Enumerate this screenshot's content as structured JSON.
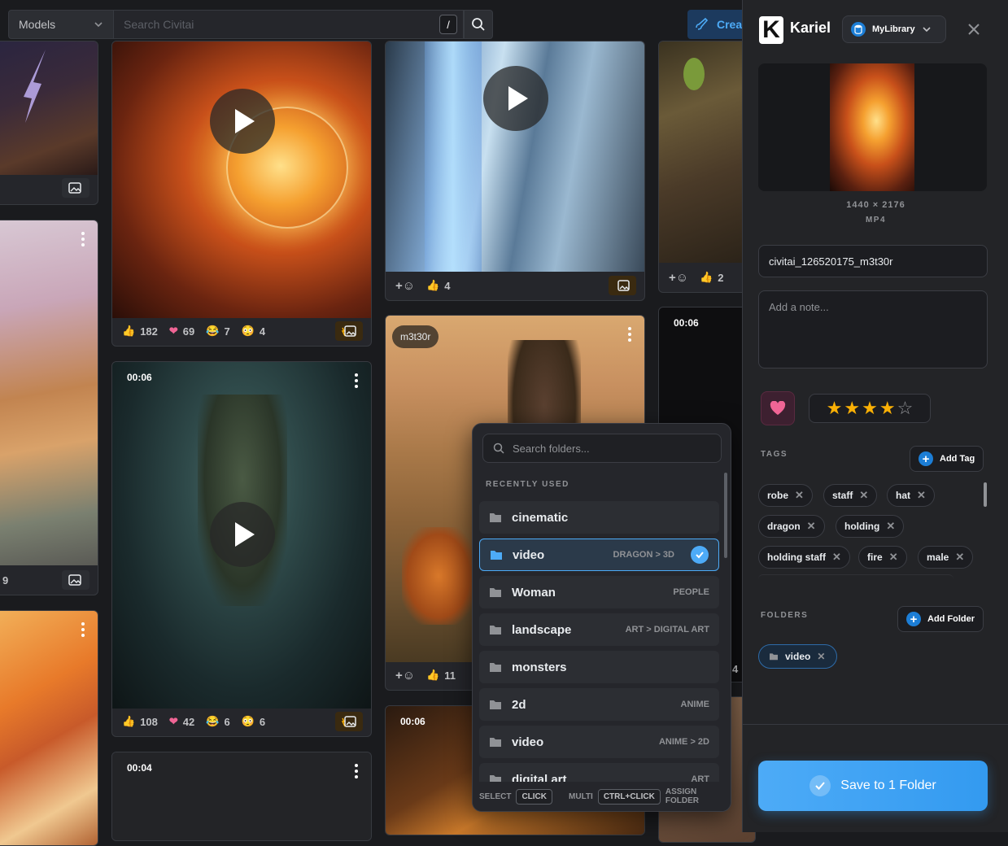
{
  "topbar": {
    "models_label": "Models",
    "search_placeholder": "Search Civitai",
    "slash_key": "/",
    "create_label": "Create"
  },
  "cards": {
    "c1": {
      "footer_count": "9"
    },
    "fire": {
      "likes": "182",
      "hearts": "69",
      "laughs": "7",
      "cries": "4"
    },
    "ice": {
      "likes": "4"
    },
    "wraith": {
      "duration": "00:06",
      "likes": "108",
      "hearts": "42",
      "laughs": "6",
      "cries": "6"
    },
    "scarecrow": {
      "user": "m3t30r",
      "likes": "11"
    },
    "bird": {
      "likes": "2"
    },
    "dark": {
      "duration": "00:06",
      "count": "4"
    },
    "bottom1": {
      "duration": "00:04"
    },
    "bottom2": {
      "duration": "00:06"
    }
  },
  "dropdown": {
    "search_placeholder": "Search folders...",
    "section_label": "RECENTLY USED",
    "folders": [
      {
        "name": "cinematic",
        "path": ""
      },
      {
        "name": "video",
        "path": "DRAGON > 3D"
      },
      {
        "name": "Woman",
        "path": "PEOPLE"
      },
      {
        "name": "landscape",
        "path": "ART > DIGITAL ART"
      },
      {
        "name": "monsters",
        "path": ""
      },
      {
        "name": "2d",
        "path": "ANIME"
      },
      {
        "name": "video",
        "path": "ANIME > 2D"
      },
      {
        "name": "digital art",
        "path": "ART"
      }
    ],
    "footer": {
      "select": "SELECT",
      "click": "CLICK",
      "multi": "MULTI",
      "ctrl_click": "CTRL+CLICK",
      "assign": "ASSIGN FOLDER"
    }
  },
  "panel": {
    "brand_letter": "K",
    "brand_name": "Kariel",
    "library_label": "MyLibrary",
    "dimensions": "1440 × 2176",
    "format": "MP4",
    "filename": "civitai_126520175_m3t30r",
    "note_placeholder": "Add a note...",
    "rating": 4,
    "rating_max": 5,
    "tags_label": "TAGS",
    "add_tag_label": "Add Tag",
    "tags": [
      "robe",
      "staff",
      "hat",
      "dragon",
      "holding",
      "holding staff",
      "fire",
      "male"
    ],
    "folders_label": "FOLDERS",
    "add_folder_label": "Add Folder",
    "assigned_folder": "video",
    "save_label": "Save to 1 Folder"
  }
}
